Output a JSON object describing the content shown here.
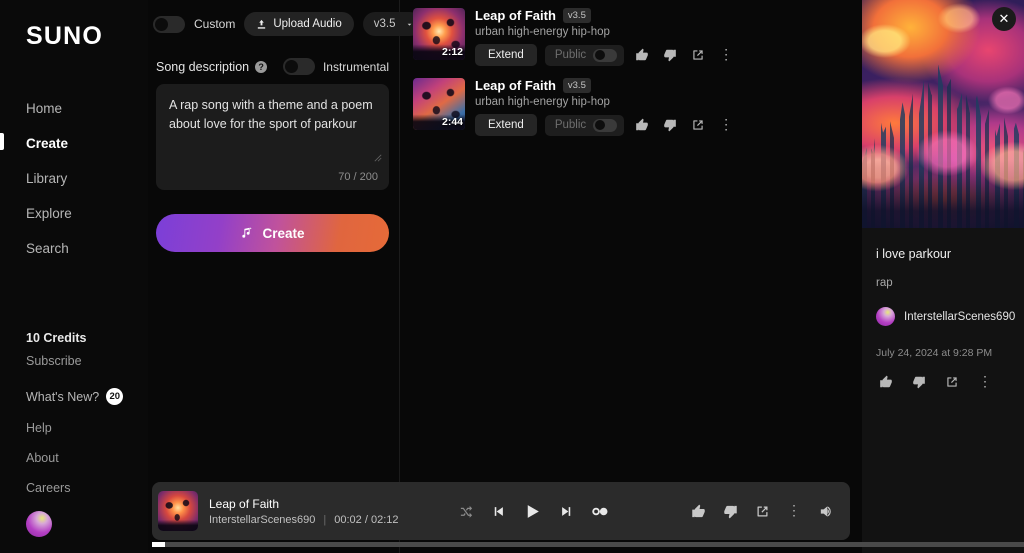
{
  "brand": {
    "logo": "SUNO"
  },
  "sidebar": {
    "nav": [
      {
        "label": "Home",
        "active": false
      },
      {
        "label": "Create",
        "active": true
      },
      {
        "label": "Library",
        "active": false
      },
      {
        "label": "Explore",
        "active": false
      },
      {
        "label": "Search",
        "active": false
      }
    ],
    "credits": "10 Credits",
    "subscribe": "Subscribe",
    "whats_new": "What's New?",
    "whats_new_badge": "20",
    "links": [
      "Help",
      "About",
      "Careers"
    ]
  },
  "create_panel": {
    "custom_label": "Custom",
    "custom_on": false,
    "upload_label": "Upload Audio",
    "version_label": "v3.5",
    "description_label": "Song description",
    "instrumental_label": "Instrumental",
    "instrumental_on": false,
    "description_value": "A rap song with a theme and a poem about love for the sport of parkour",
    "counter": "70 / 200",
    "create_label": "Create"
  },
  "songs": [
    {
      "title": "Leap of Faith",
      "version": "v3.5",
      "style": "urban high-energy hip-hop",
      "duration": "2:12",
      "extend_label": "Extend",
      "public_label": "Public",
      "public_on": false
    },
    {
      "title": "Leap of Faith",
      "version": "v3.5",
      "style": "urban high-energy hip-hop",
      "duration": "2:44",
      "extend_label": "Extend",
      "public_label": "Public",
      "public_on": false
    }
  ],
  "detail_panel": {
    "title": "i love parkour",
    "tag": "rap",
    "user": "InterstellarScenes690",
    "date": "July 24, 2024 at 9:28 PM"
  },
  "player": {
    "title": "Leap of Faith",
    "artist": "InterstellarScenes690",
    "time": "00:02 / 02:12",
    "progress_percent": 1.5
  },
  "colors": {
    "accent_purple": "#7b3fd8",
    "accent_orange": "#e66a38",
    "background": "#080808",
    "panel": "#121212"
  }
}
